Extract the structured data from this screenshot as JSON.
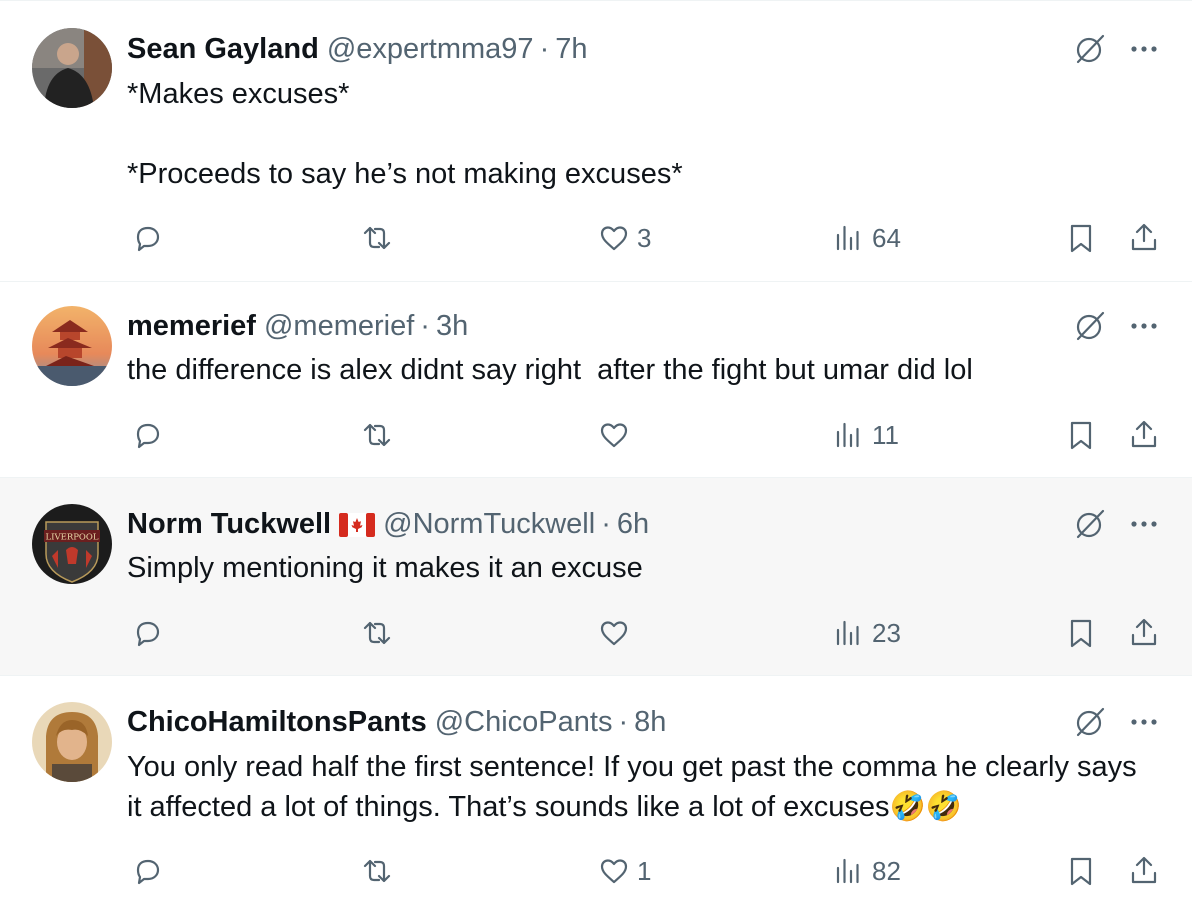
{
  "tweets": [
    {
      "name": "Sean Gayland",
      "handle": "@expertmma97",
      "separator": "·",
      "time": "7h",
      "avatar": "avatar-photo-person-dark-jacket",
      "text": "*Makes excuses*\n\n*Proceeds to say he’s not making excuses*",
      "replies": "",
      "reposts": "",
      "likes": "3",
      "views": "64"
    },
    {
      "name": "memerief",
      "handle": "@memerief",
      "separator": "·",
      "time": "3h",
      "avatar": "avatar-photo-pagoda-sunset",
      "text": "the difference is alex didnt say right  after the fight but umar did lol",
      "replies": "",
      "reposts": "",
      "likes": "",
      "views": "11"
    },
    {
      "name": "Norm Tuckwell",
      "flag": "canada-flag-icon",
      "handle": "@NormTuckwell",
      "separator": "·",
      "time": "6h",
      "avatar": "avatar-liverpool-crest",
      "avatar_text": "LIVERPOOL",
      "text": "Simply mentioning it makes it an excuse",
      "replies": "",
      "reposts": "",
      "likes": "",
      "views": "23"
    },
    {
      "name": "ChicoHamiltonsPants",
      "handle": "@ChicoPants",
      "separator": "·",
      "time": "8h",
      "avatar": "avatar-photo-person-blond",
      "text": "You only read half the first sentence! If you get past the comma he clearly says it affected a lot of things. That’s sounds like a lot of excuses🤣🤣",
      "replies": "",
      "reposts": "",
      "likes": "1",
      "views": "82"
    }
  ],
  "icons": {
    "reply": "reply-icon",
    "repost": "repost-icon",
    "like": "like-icon",
    "views": "views-icon",
    "bookmark": "bookmark-icon",
    "share": "share-icon",
    "grok": "grok-icon",
    "more": "more-icon"
  },
  "colors": {
    "text_primary": "#0f1419",
    "text_secondary": "#536471",
    "divider": "#eff3f4",
    "hover_background": "#f7f7f7",
    "flag_red": "#d52b1e"
  }
}
